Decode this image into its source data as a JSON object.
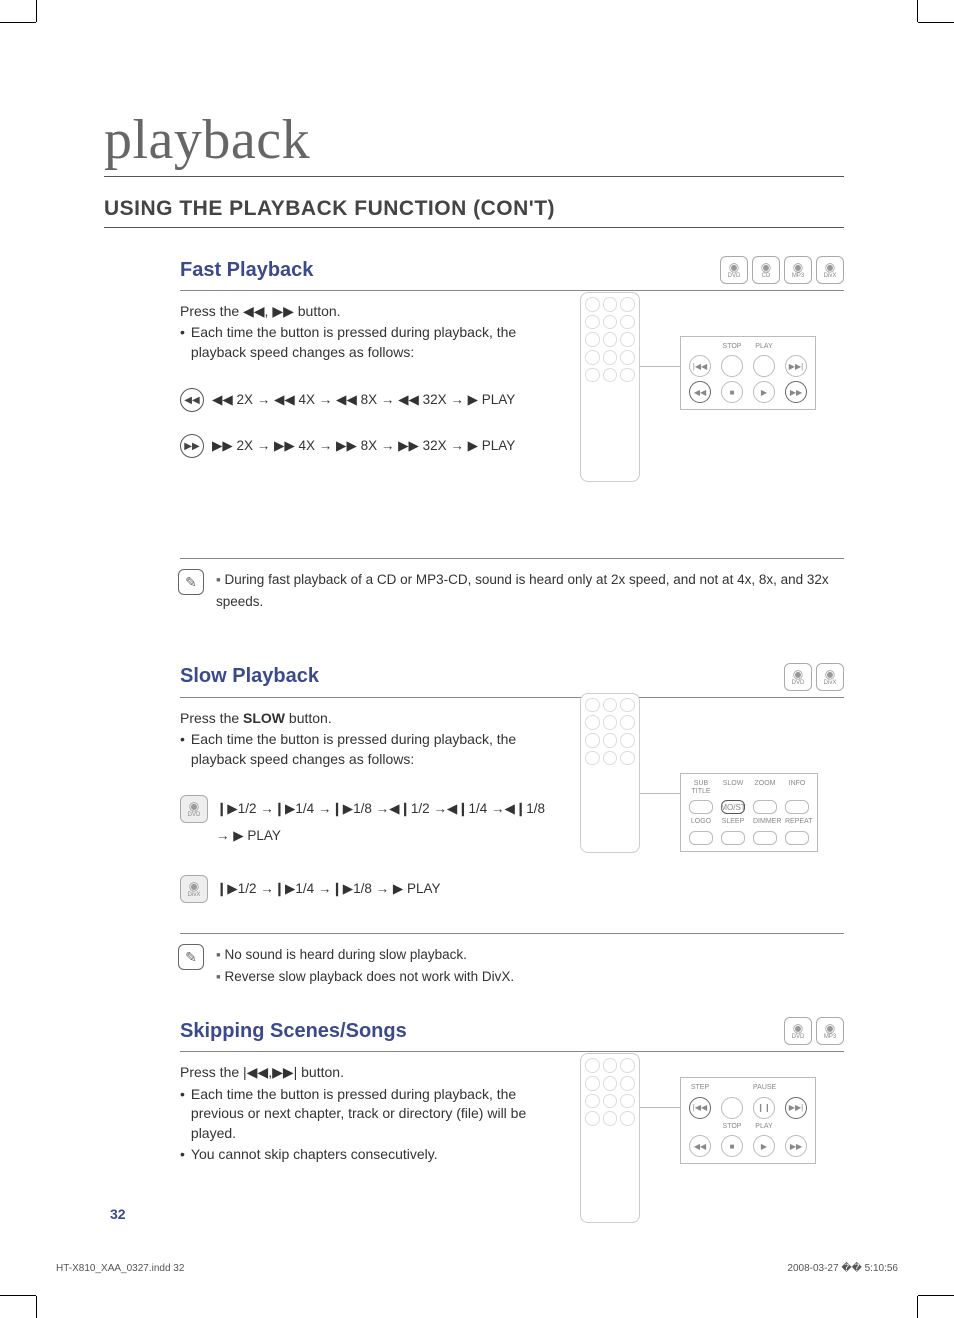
{
  "page": {
    "title": "playback",
    "heading": "USING THE PLAYBACK FUNCTION (CON'T)",
    "number": "32",
    "footer_left": "HT-X810_XAA_0327.indd   32",
    "footer_right": "2008-03-27   �� 5:10:56"
  },
  "fast": {
    "title": "Fast Playback",
    "discs": [
      "DVD",
      "CD",
      "MP3",
      "DivX"
    ],
    "press": "Press the ◀◀, ▶▶ button.",
    "bullet": "Each time the button is pressed during playback, the playback speed changes as follows:",
    "seq_rew_icon": "◀◀",
    "seq_rew": "◀◀ 2X  →  ◀◀ 4X  →  ◀◀ 8X  →  ◀◀ 32X  →  ▶ PLAY",
    "seq_ff_icon": "▶▶",
    "seq_ff": "▶▶ 2X  →  ▶▶ 4X  →  ▶▶ 8X  →  ▶▶ 32X  →  ▶ PLAY",
    "note": "During fast playback of a CD or MP3-CD, sound is heard only at 2x speed, and not at 4x, 8x, and 32x speeds.",
    "callout": {
      "labels": [
        "",
        "STOP",
        "PLAY",
        ""
      ],
      "icons": [
        "|◀◀",
        "",
        "",
        "▶▶|",
        "◀◀",
        "■",
        "▶",
        "▶▶"
      ]
    }
  },
  "slow": {
    "title": "Slow Playback",
    "discs": [
      "DVD",
      "DivX"
    ],
    "press": "Press the SLOW button.",
    "press_prefix": "Press the ",
    "press_bold": "SLOW",
    "press_suffix": " button.",
    "bullet": "Each time the button is pressed during playback, the playback speed changes as follows:",
    "dvd_label": "DVD",
    "dvd_seq": "❙▶1/2 →❙▶1/4 →❙▶1/8 →◀❙1/2 →◀❙1/4 →◀❙1/8 → ▶ PLAY",
    "divx_label": "DivX",
    "divx_seq": "❙▶1/2 →❙▶1/4 →❙▶1/8 → ▶ PLAY",
    "note1": "No sound is heard during slow playback.",
    "note2": "Reverse slow playback does not work with DivX.",
    "callout": {
      "row1": [
        "SUB TITLE",
        "SLOW",
        "ZOOM",
        "INFO"
      ],
      "row2": [
        "LOGO",
        "SLEEP",
        "DIMMER",
        "REPEAT"
      ],
      "buttons": [
        "MO/ST"
      ]
    }
  },
  "skip": {
    "title": "Skipping Scenes/Songs",
    "discs": [
      "DVD",
      "MP3"
    ],
    "press": "Press the |◀◀,▶▶| button.",
    "bullet1": "Each time the button is pressed during playback, the previous or next chapter, track or directory (file) will be played.",
    "bullet2": "You cannot skip chapters consecutively.",
    "callout": {
      "row1_lab": [
        "STEP",
        "",
        "PAUSE",
        ""
      ],
      "row1_ico": [
        "|◀◀",
        "",
        "❙❙",
        "▶▶|"
      ],
      "row2_lab": [
        "",
        "STOP",
        "PLAY",
        ""
      ],
      "row2_ico": [
        "◀◀",
        "■",
        "▶",
        "▶▶"
      ]
    }
  }
}
